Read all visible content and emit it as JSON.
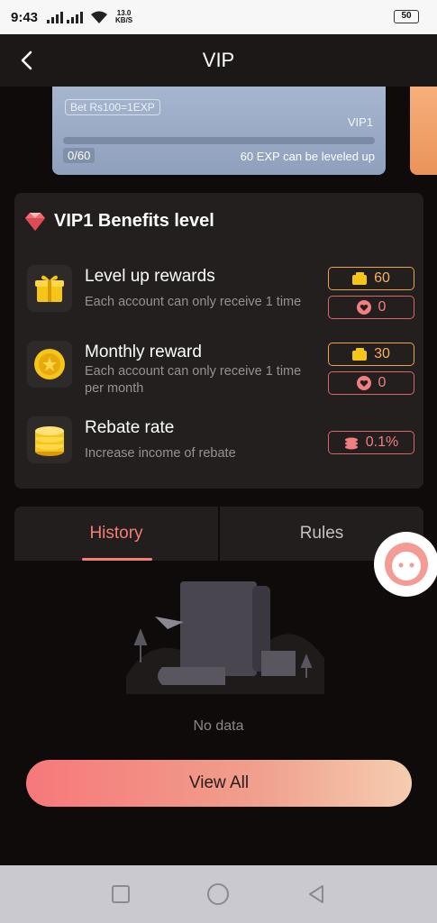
{
  "status": {
    "time": "9:43",
    "net_speed": "13.0",
    "net_unit": "KB/S",
    "battery": "50"
  },
  "header": {
    "title": "VIP"
  },
  "vip_card": {
    "exp_rule": "Bet Rs100=1EXP",
    "level": "VIP1",
    "progress_text": "0/60",
    "progress_value": 0,
    "need_text": "60 EXP can be leveled up"
  },
  "benefits": {
    "title": "VIP1 Benefits level",
    "items": [
      {
        "name": "Level up rewards",
        "desc": "Each account can only receive 1 time",
        "gold": "60",
        "red": "0"
      },
      {
        "name": "Monthly reward",
        "desc": "Each account can only receive 1 time per month",
        "gold": "30",
        "red": "0"
      },
      {
        "name": "Rebate rate",
        "desc": "Increase income of rebate",
        "rate": "0.1%"
      }
    ]
  },
  "tabs": {
    "history": "History",
    "rules": "Rules"
  },
  "empty": {
    "text": "No data"
  },
  "view_all": "View All",
  "colors": {
    "accent": "#f47f76",
    "gold": "#e8a34b",
    "card": "#241f1f"
  }
}
